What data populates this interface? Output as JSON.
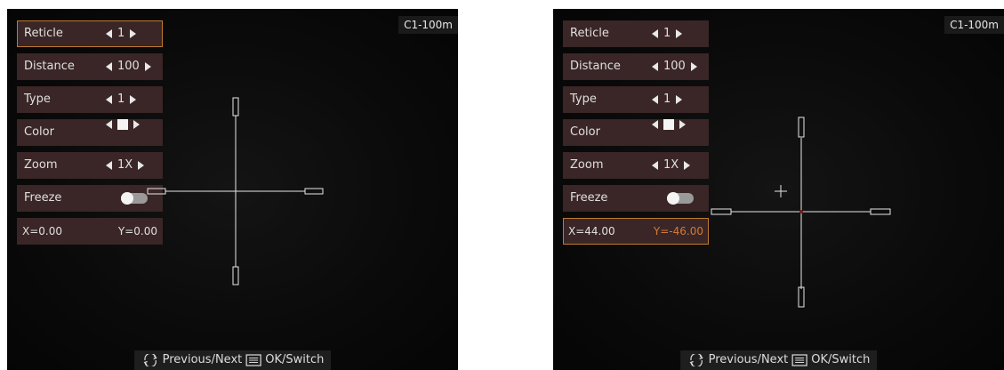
{
  "left_screen": {
    "profile_tag": "C1-100m",
    "menu": {
      "reticle": {
        "label": "Reticle",
        "value": "1"
      },
      "distance": {
        "label": "Distance",
        "value": "100"
      },
      "type": {
        "label": "Type",
        "value": "1"
      },
      "color": {
        "label": "Color",
        "value_icon": "white-square-swatch",
        "value_color": "#ffffff"
      },
      "zoom": {
        "label": "Zoom",
        "value": "1X"
      },
      "freeze": {
        "label": "Freeze",
        "state": "off"
      },
      "coords": {
        "x": "X=0.00",
        "y": "Y=0.00"
      }
    },
    "hint": {
      "prev_next": "Previous/Next",
      "ok_switch": "OK/Switch"
    }
  },
  "right_screen": {
    "profile_tag": "C1-100m",
    "menu": {
      "reticle": {
        "label": "Reticle",
        "value": "1"
      },
      "distance": {
        "label": "Distance",
        "value": "100"
      },
      "type": {
        "label": "Type",
        "value": "1"
      },
      "color": {
        "label": "Color",
        "value_icon": "white-square-swatch",
        "value_color": "#ffffff"
      },
      "zoom": {
        "label": "Zoom",
        "value": "1X"
      },
      "freeze": {
        "label": "Freeze",
        "state": "off"
      },
      "coords": {
        "x": "X=44.00",
        "y": "Y=-46.00"
      }
    },
    "hint": {
      "prev_next": "Previous/Next",
      "ok_switch": "OK/Switch"
    }
  },
  "colors": {
    "menu_bg": "#3a2626",
    "selection_outline": "#c07a30",
    "highlight_text": "#d07a38"
  }
}
